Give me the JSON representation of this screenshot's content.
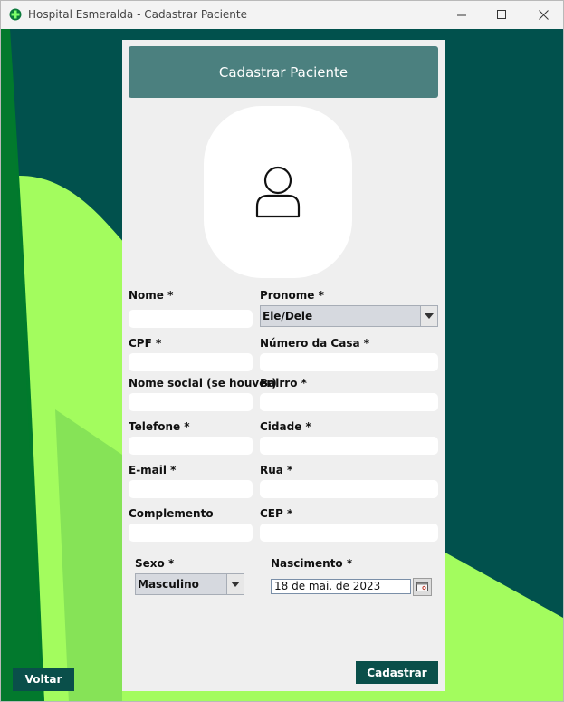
{
  "window": {
    "title": "Hospital Esmeralda - Cadastrar Paciente"
  },
  "header": {
    "title": "Cadastrar Paciente"
  },
  "form": {
    "nome_label": "Nome *",
    "pronome_label": "Pronome *",
    "pronome_value": "Ele/Dele",
    "cpf_label": "CPF *",
    "numero_label": "Número da Casa *",
    "nome_social_label": "Nome social (se houver)",
    "bairro_label": "Bairro *",
    "telefone_label": "Telefone *",
    "cidade_label": "Cidade *",
    "email_label": "E-mail *",
    "rua_label": "Rua *",
    "complemento_label": "Complemento",
    "cep_label": "CEP *",
    "sexo_label": "Sexo *",
    "sexo_value": "Masculino",
    "nascimento_label": "Nascimento *",
    "nascimento_value": "18 de mai. de 2023"
  },
  "buttons": {
    "voltar": "Voltar",
    "cadastrar": "Cadastrar"
  },
  "colors": {
    "background_dark": "#01514d",
    "background_green": "#00782c",
    "background_lime": "#a3fc5e",
    "header": "#4b807f",
    "button": "#0a4f4a"
  },
  "icons": [
    "hospital-logo-icon",
    "minimize-icon",
    "maximize-icon",
    "close-icon",
    "user-icon",
    "chevron-down-icon",
    "calendar-icon"
  ]
}
